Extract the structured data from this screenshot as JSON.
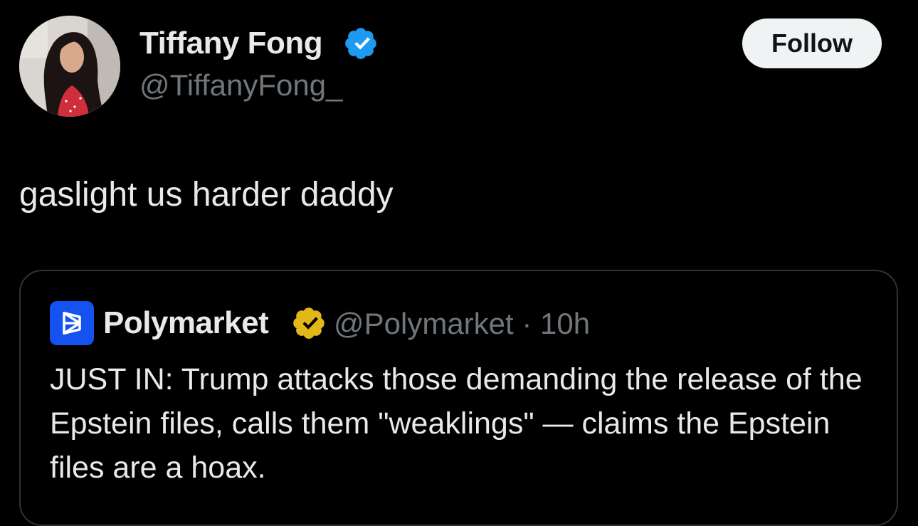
{
  "tweet": {
    "author": {
      "display_name": "Tiffany Fong",
      "handle": "@TiffanyFong_",
      "verified": "blue"
    },
    "follow_label": "Follow",
    "text": "gaslight us harder daddy"
  },
  "quoted_tweet": {
    "author": {
      "display_name": "Polymarket",
      "handle": "@Polymarket",
      "verified": "gold",
      "avatar_icon": "polymarket-logo-icon"
    },
    "separator": "·",
    "time_ago": "10h",
    "text": "JUST IN: Trump attacks those demanding the release of the Epstein files, calls them \"weaklings\" — claims the Epstein files are a hoax."
  },
  "colors": {
    "background": "#000000",
    "primary_text": "#e7e9ea",
    "secondary_text": "#71767b",
    "verified_blue": "#1d9bf0",
    "verified_gold": "#e2b719",
    "polymarket_blue": "#1652f0",
    "follow_button_bg": "#eff3f4",
    "card_border": "#2f3336"
  }
}
